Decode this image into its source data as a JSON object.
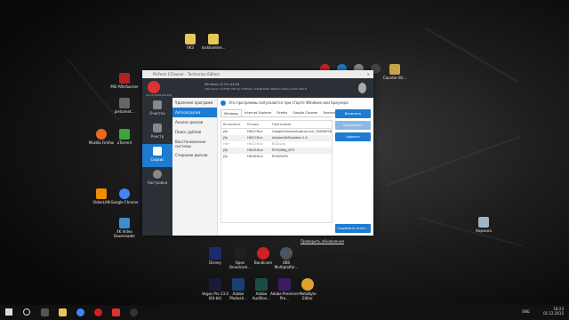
{
  "desktop": {
    "icons_left": [
      {
        "label": "VK3",
        "color": "#e8c65a"
      },
      {
        "label": "rocklionline...",
        "color": "#e8c65a"
      },
      {
        "label": "MSI Afterburner",
        "color": "#b52020"
      },
      {
        "label": "pietsmiet...",
        "color": "#666666"
      },
      {
        "label": "Mozilla Firefox",
        "color": "#e86a1e"
      },
      {
        "label": "uTorrent",
        "color": "#3aa63a"
      },
      {
        "label": "VideoLAN",
        "color": "#f08c00"
      },
      {
        "label": "Google Chrome",
        "color": "#4285f4"
      },
      {
        "label": "4K Video Downloader",
        "color": "#3b8ed0"
      }
    ],
    "icons_right": [
      {
        "label": "Counter-Str...",
        "color": "#c9a14a"
      },
      {
        "label": "Корзина",
        "color": "#9fb6c8"
      }
    ],
    "dock_row1": [
      {
        "label": "Disney",
        "color": "#1c2b6b"
      },
      {
        "label": "Open Broadcast...",
        "color": "#202020"
      },
      {
        "label": "Bandicam",
        "color": "#d02020"
      },
      {
        "label": "OBS Multiplatfor...",
        "color": "#4b5560"
      }
    ],
    "dock_row2": [
      {
        "label": "Vegas Pro 13.0 (64-bit)",
        "color": "#1a1a3a"
      },
      {
        "label": "Adobe Photosh...",
        "color": "#1c3f73"
      },
      {
        "label": "Adobe Audition...",
        "color": "#1a4d45"
      },
      {
        "label": "Adobe Premiere Pro...",
        "color": "#3b1c60"
      },
      {
        "label": "MetaByte Editor",
        "color": "#e0a030"
      }
    ]
  },
  "ccleaner": {
    "title": "Piriform CCleaner - Technician Edition",
    "version": "v5.11.5408 (64-bit)",
    "sysinfo1": "Windows 10 Pro 64-bit",
    "sysinfo2": "Intel Core i7-3770K CPU @ 3.50GHz, 8,0GB RAM, NVIDIA GeForce GTX 660 Ti",
    "nav": [
      {
        "label": "Очистка",
        "active": false
      },
      {
        "label": "Реестр",
        "active": false
      },
      {
        "label": "Сервис",
        "active": true
      },
      {
        "label": "Настройки",
        "active": false
      }
    ],
    "subnav": [
      {
        "label": "Удаление программ",
        "active": false
      },
      {
        "label": "Автозагрузка",
        "active": true
      },
      {
        "label": "Анализ дисков",
        "active": false
      },
      {
        "label": "Поиск дублей",
        "active": false
      },
      {
        "label": "Восстановление системы",
        "active": false
      },
      {
        "label": "Стирание дисков",
        "active": false
      }
    ],
    "info_text": "Эти программы запускаются при старте Windows или браузера",
    "tabs": [
      "Windows",
      "Internet Explorer",
      "Firefox",
      "Google Chrome",
      "Заплан"
    ],
    "grid_headers": [
      "Включено",
      "Раздел",
      "Программа"
    ],
    "rows": [
      {
        "enabled": "Да",
        "section": "HKCU:Run",
        "program": "GoogleChromeAutoLaunch_7A9D3EC8EA985"
      },
      {
        "enabled": "Да",
        "section": "HKCU:Run",
        "program": "AdobeAAMUpdater-1.0"
      },
      {
        "enabled": "Нет",
        "section": "HKCU:Run",
        "program": "BCDLpro"
      },
      {
        "enabled": "Да",
        "section": "HKLM:Run",
        "program": "RTHDVBg_DTS"
      },
      {
        "enabled": "Да",
        "section": "HKLM:Run",
        "program": "RTHDVCPL"
      }
    ],
    "buttons": {
      "enable": "Включить",
      "disable": "Выключить",
      "delete": "Удалить",
      "save": "Сохранить отчет..."
    },
    "footer_link": "Проверить обновления"
  },
  "taskbar": {
    "time": "18:23",
    "date": "01.12.2015",
    "lang": "ENG"
  }
}
